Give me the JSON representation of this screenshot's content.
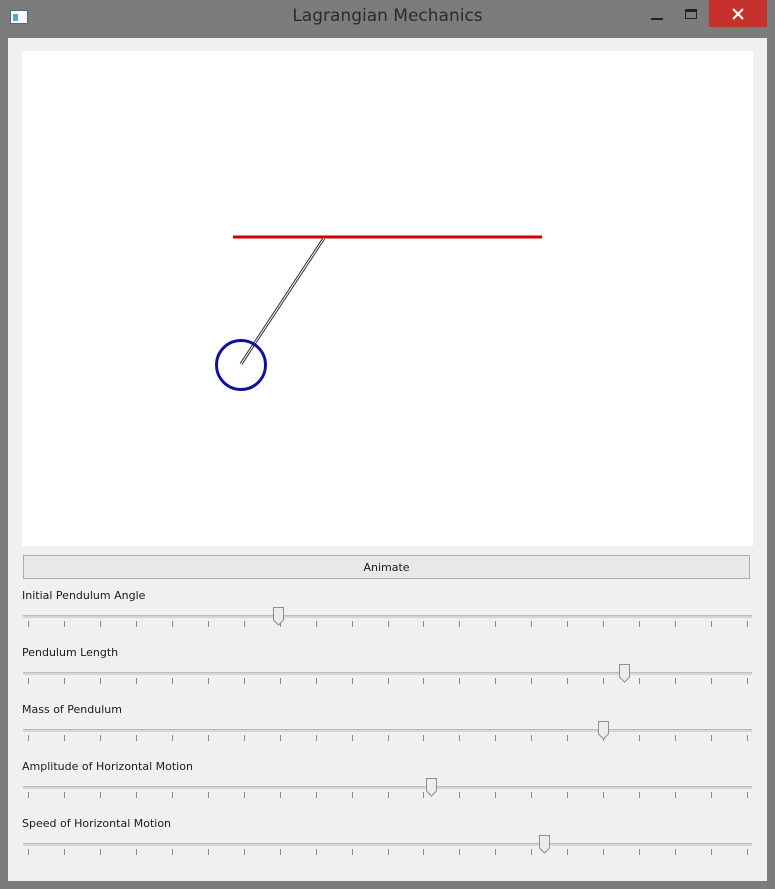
{
  "window": {
    "title": "Lagrangian Mechanics",
    "colors": {
      "frame": "#7c7c7c",
      "close_button": "#c7312b"
    }
  },
  "canvas": {
    "colors": {
      "rail": "#cc0000",
      "bob": "#1010a0",
      "rod": "#333333"
    }
  },
  "controls": {
    "animate_label": "Animate",
    "sliders": [
      {
        "label": "Initial Pendulum Angle",
        "value": 0.35
      },
      {
        "label": "Pendulum Length",
        "value": 0.825
      },
      {
        "label": "Mass of Pendulum",
        "value": 0.795
      },
      {
        "label": "Amplitude of Horizontal Motion",
        "value": 0.56
      },
      {
        "label": "Speed of Horizontal Motion",
        "value": 0.715
      }
    ],
    "tick_count": 21
  }
}
